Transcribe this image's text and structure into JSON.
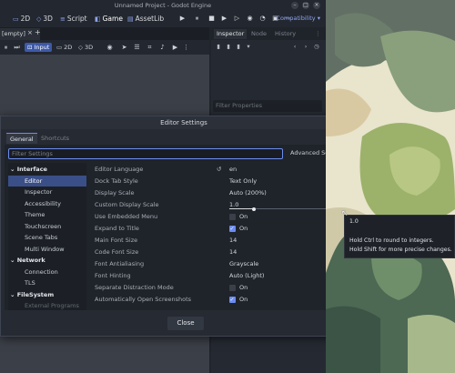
{
  "window": {
    "title": "Unnamed Project - Godot Engine",
    "controls": [
      "–",
      "□",
      "×"
    ]
  },
  "workspaces": [
    {
      "label": "2D",
      "icon": "2d-icon"
    },
    {
      "label": "3D",
      "icon": "3d-icon"
    },
    {
      "label": "Script",
      "icon": "script-icon"
    },
    {
      "label": "Game",
      "icon": "game-icon",
      "active": true
    },
    {
      "label": "AssetLib",
      "icon": "assetlib-icon"
    }
  ],
  "run_buttons": [
    "▶",
    "⏸",
    "■",
    "▶",
    "▷",
    "◉",
    "◔",
    "▣",
    "⋯"
  ],
  "renderer": "Compatibility ▾",
  "scene_tab": {
    "label": "[empty]",
    "close": "×",
    "add": "+"
  },
  "viewport_toolbar": {
    "input_label": "Input",
    "mode_2d": "2D",
    "mode_3d": "3D"
  },
  "dock": {
    "tabs": [
      "Inspector",
      "Node",
      "History"
    ],
    "filter_placeholder": "Filter Properties"
  },
  "dialog": {
    "title": "Editor Settings",
    "close": "×",
    "tabs": [
      "General",
      "Shortcuts"
    ],
    "filter_placeholder": "Filter Settings",
    "advanced_label": "Advanced Settings",
    "close_button": "Close"
  },
  "tree": [
    {
      "label": "Interface",
      "kind": "section"
    },
    {
      "label": "Editor",
      "kind": "child",
      "selected": true
    },
    {
      "label": "Inspector",
      "kind": "child"
    },
    {
      "label": "Accessibility",
      "kind": "child"
    },
    {
      "label": "Theme",
      "kind": "child"
    },
    {
      "label": "Touchscreen",
      "kind": "child"
    },
    {
      "label": "Scene Tabs",
      "kind": "child"
    },
    {
      "label": "Multi Window",
      "kind": "child"
    },
    {
      "label": "Network",
      "kind": "section"
    },
    {
      "label": "Connection",
      "kind": "child"
    },
    {
      "label": "TLS",
      "kind": "child"
    },
    {
      "label": "FileSystem",
      "kind": "section"
    },
    {
      "label": "External Programs",
      "kind": "child dim"
    }
  ],
  "props": [
    {
      "name": "Editor Language",
      "value": "en",
      "type": "enum",
      "revert": true
    },
    {
      "name": "Dock Tab Style",
      "value": "Text Only",
      "type": "enum"
    },
    {
      "name": "Display Scale",
      "value": "Auto (200%)",
      "type": "enum"
    },
    {
      "name": "Custom Display Scale",
      "value": "1.0",
      "type": "slider",
      "fraction": 0.2
    },
    {
      "name": "Use Embedded Menu",
      "value": "On",
      "type": "check",
      "checked": false
    },
    {
      "name": "Expand to Title",
      "value": "On",
      "type": "check",
      "checked": true
    },
    {
      "name": "Main Font Size",
      "value": "14",
      "type": "number"
    },
    {
      "name": "Code Font Size",
      "value": "14",
      "type": "number",
      "spin": true
    },
    {
      "name": "Font Antialiasing",
      "value": "Grayscale",
      "type": "enum"
    },
    {
      "name": "Font Hinting",
      "value": "Auto (Light)",
      "type": "enum"
    },
    {
      "name": "Separate Distraction Mode",
      "value": "On",
      "type": "check",
      "checked": false
    },
    {
      "name": "Automatically Open Screenshots",
      "value": "On",
      "type": "check",
      "checked": true
    }
  ],
  "tooltip": {
    "value": "1.0",
    "line1": "Hold Ctrl to round to integers.",
    "line2": "Hold Shift for more precise changes."
  },
  "colors": {
    "accent": "#6b8cf0",
    "selected_bg": "#3a4f87",
    "panel": "#262a32"
  }
}
